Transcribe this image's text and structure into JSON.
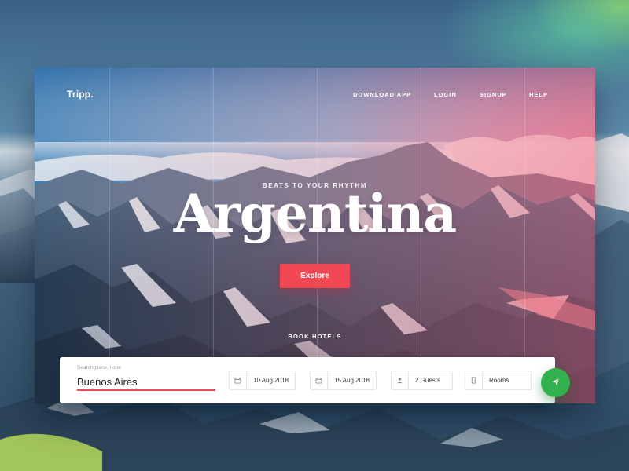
{
  "brand": {
    "logo": "Tripp."
  },
  "nav": {
    "items": [
      {
        "label": "DOWNLOAD APP"
      },
      {
        "label": "LOGIN"
      },
      {
        "label": "SIGNUP"
      },
      {
        "label": "HELP"
      }
    ]
  },
  "hero": {
    "tagline": "BEATS TO YOUR RHYTHM",
    "title": "Argentina",
    "explore_label": "Explore",
    "book_label": "BOOK HOTELS"
  },
  "booking": {
    "search_hint": "Search place, hotel",
    "search_value": "Buenos Aires",
    "checkin": {
      "icon": "calendar-icon",
      "value": "10 Aug 2018"
    },
    "checkout": {
      "icon": "calendar-icon",
      "value": "15 Aug 2018"
    },
    "guests": {
      "icon": "person-icon",
      "value": "2 Guests"
    },
    "rooms": {
      "icon": "door-icon",
      "value": "Rooms"
    },
    "submit_icon": "send-icon"
  },
  "colors": {
    "accent": "#f04955",
    "submit": "#34b14f",
    "text_dark": "#222222"
  }
}
